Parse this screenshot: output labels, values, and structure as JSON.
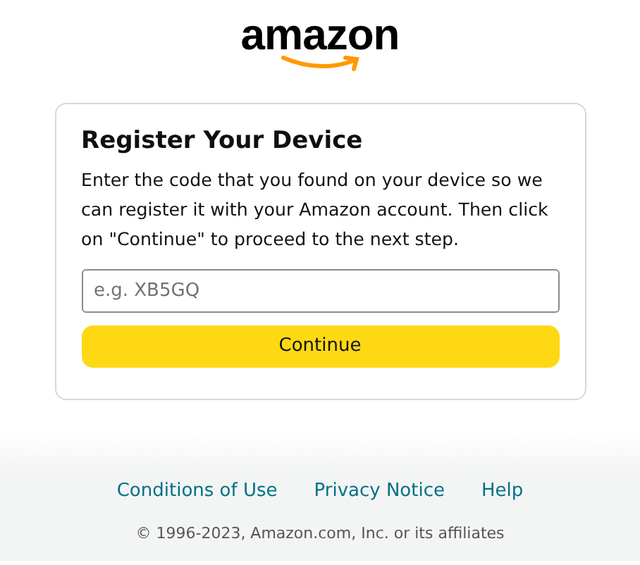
{
  "logo": {
    "text": "amazon"
  },
  "card": {
    "title": "Register Your Device",
    "description": "Enter the code that you found on your device so we can register it with your Amazon account. Then click on \"Continue\" to proceed to the next step.",
    "code_field": {
      "placeholder": "e.g. XB5GQ"
    },
    "button": "Continue"
  },
  "footer": {
    "links": [
      "Conditions of Use",
      "Privacy Notice",
      "Help"
    ],
    "copyright": "© 1996-2023, Amazon.com, Inc. or its affiliates"
  }
}
